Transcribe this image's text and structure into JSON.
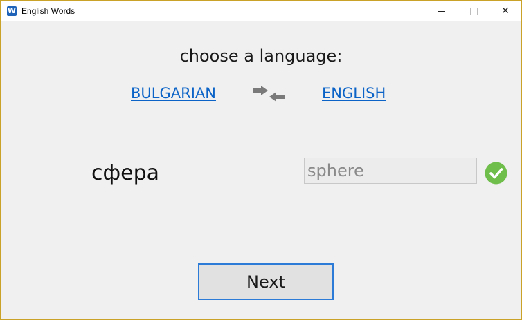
{
  "window": {
    "title": "English Words",
    "icon_letter": "W",
    "accent": "#1e63b8"
  },
  "heading": "choose a language:",
  "languages": {
    "source": "BULGARIAN",
    "target": "ENGLISH",
    "swap_icon": "swap-arrows-icon"
  },
  "quiz": {
    "word": "сфера",
    "answer_value": "sphere",
    "status_icon": "check-circle-icon",
    "status_color": "#6fbd4a"
  },
  "next_label": "Next"
}
